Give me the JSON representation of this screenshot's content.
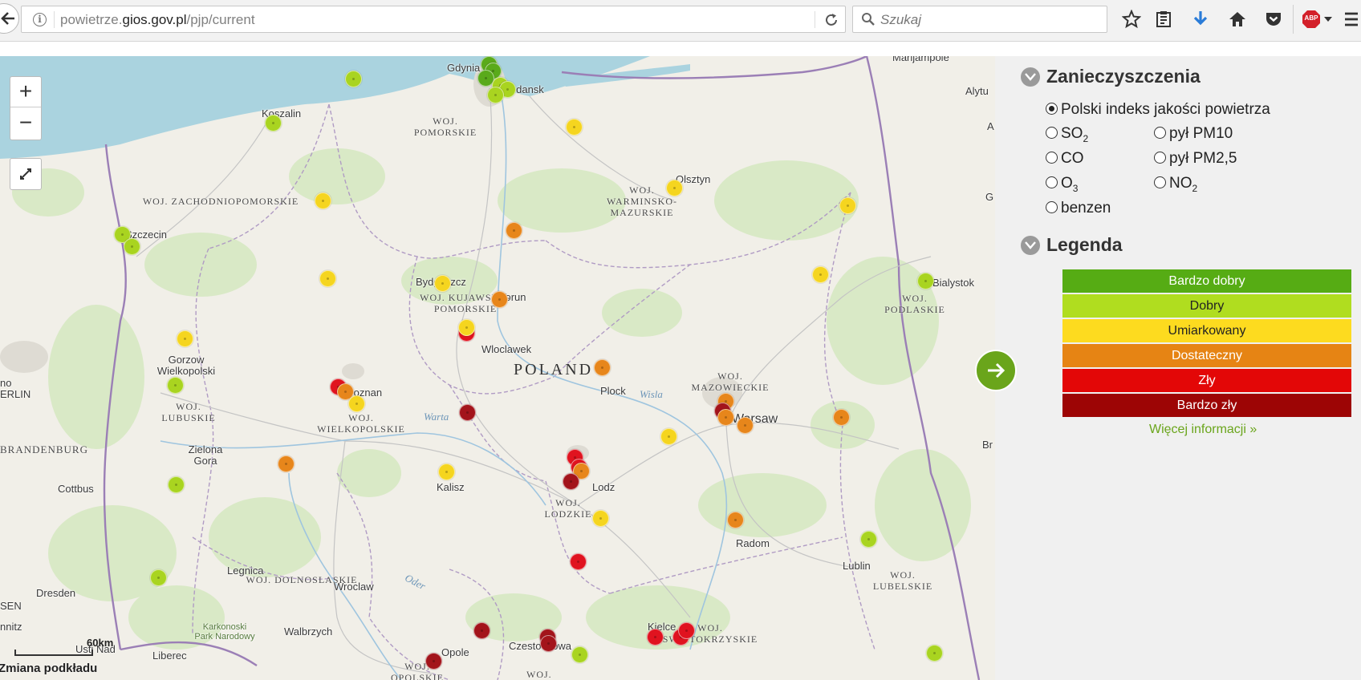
{
  "browser": {
    "url_prefix": "powietrze.",
    "url_domain": "gios.gov.pl",
    "url_path": "/pjp/current",
    "search_placeholder": "Szukaj",
    "abp_label": "ABP"
  },
  "map": {
    "country_label": "POLAND",
    "zoom_in_label": "+",
    "zoom_out_label": "−",
    "scale_label": "60km",
    "basemap_button": "Zmiana podkładu",
    "places": [
      "Gdynia",
      "Gdansk",
      "Koszalin",
      "Olsztyn",
      "Szczecin",
      "Bydgoszcz",
      "Torun",
      "Wloclawek",
      "Gorzow Wielkopolski",
      "Poznan",
      "Plock",
      "Warsaw",
      "Bialystok",
      "Zielona Gora",
      "Kalisz",
      "Lodz",
      "Cottbus",
      "Radom",
      "Legnica",
      "Wroclaw",
      "Lublin",
      "Dresden",
      "Walbrzych",
      "Kielce",
      "Liberec",
      "Opole",
      "Czestochowa",
      "Marijampole",
      "Alytu",
      "Brb",
      "Br",
      "G",
      "A"
    ],
    "edge_labels": [
      "no",
      "ERLIN",
      "BRANDENBURG",
      "SEN",
      "nnitz",
      "Usti Nad",
      "Karkonoski Park Narodowy"
    ],
    "regions": [
      "WOJ. POMORSKIE",
      "WOJ. ZACHODNIOPOMORSKIE",
      "WOJ. WARMINSKO-MAZURSKIE",
      "WOJ. KUJAWSKO-POMORSKIE",
      "WOJ. PODLASKIE",
      "WOJ. LUBUSKIE",
      "WOJ. WIELKOPOLSKIE",
      "WOJ. MAZOWIECKIE",
      "WOJ. LODZKIE",
      "WOJ. LUBELSKIE",
      "WOJ. DOLNOSLASKIE",
      "WOJ. SWIETOKRZYSKIE",
      "WOJ. OPOLSKIE",
      "WOJ."
    ],
    "rivers": [
      "Wisla",
      "Warta",
      "Oder"
    ],
    "station_levels": {
      "bardzo_dobry": "#5aaa1b",
      "dobry": "#a9d420",
      "umiarkowany": "#f5d51f",
      "dostateczny": "#e7861b",
      "zly": "#e0131f",
      "bardzo_zly": "#a3141b"
    }
  },
  "sidebar": {
    "pollutants_title": "Zanieczyszczenia",
    "options": {
      "index": "Polski indeks jakości powietrza",
      "so2": "SO",
      "so2_sub": "2",
      "pm10": "pył PM10",
      "co": "CO",
      "pm25": "pył PM2,5",
      "o3": "O",
      "o3_sub": "3",
      "no2": "NO",
      "no2_sub": "2",
      "benzen": "benzen"
    },
    "legend_title": "Legenda",
    "legend": [
      {
        "label": "Bardzo dobry",
        "color": "#56ac14"
      },
      {
        "label": "Dobry",
        "color": "#b0dd1f"
      },
      {
        "label": "Umiarkowany",
        "color": "#fddb1f"
      },
      {
        "label": "Dostateczny",
        "color": "#e68414"
      },
      {
        "label": "Zły",
        "color": "#e30707"
      },
      {
        "label": "Bardzo zły",
        "color": "#9d0505"
      }
    ],
    "more_info": "Więcej informacji »"
  }
}
